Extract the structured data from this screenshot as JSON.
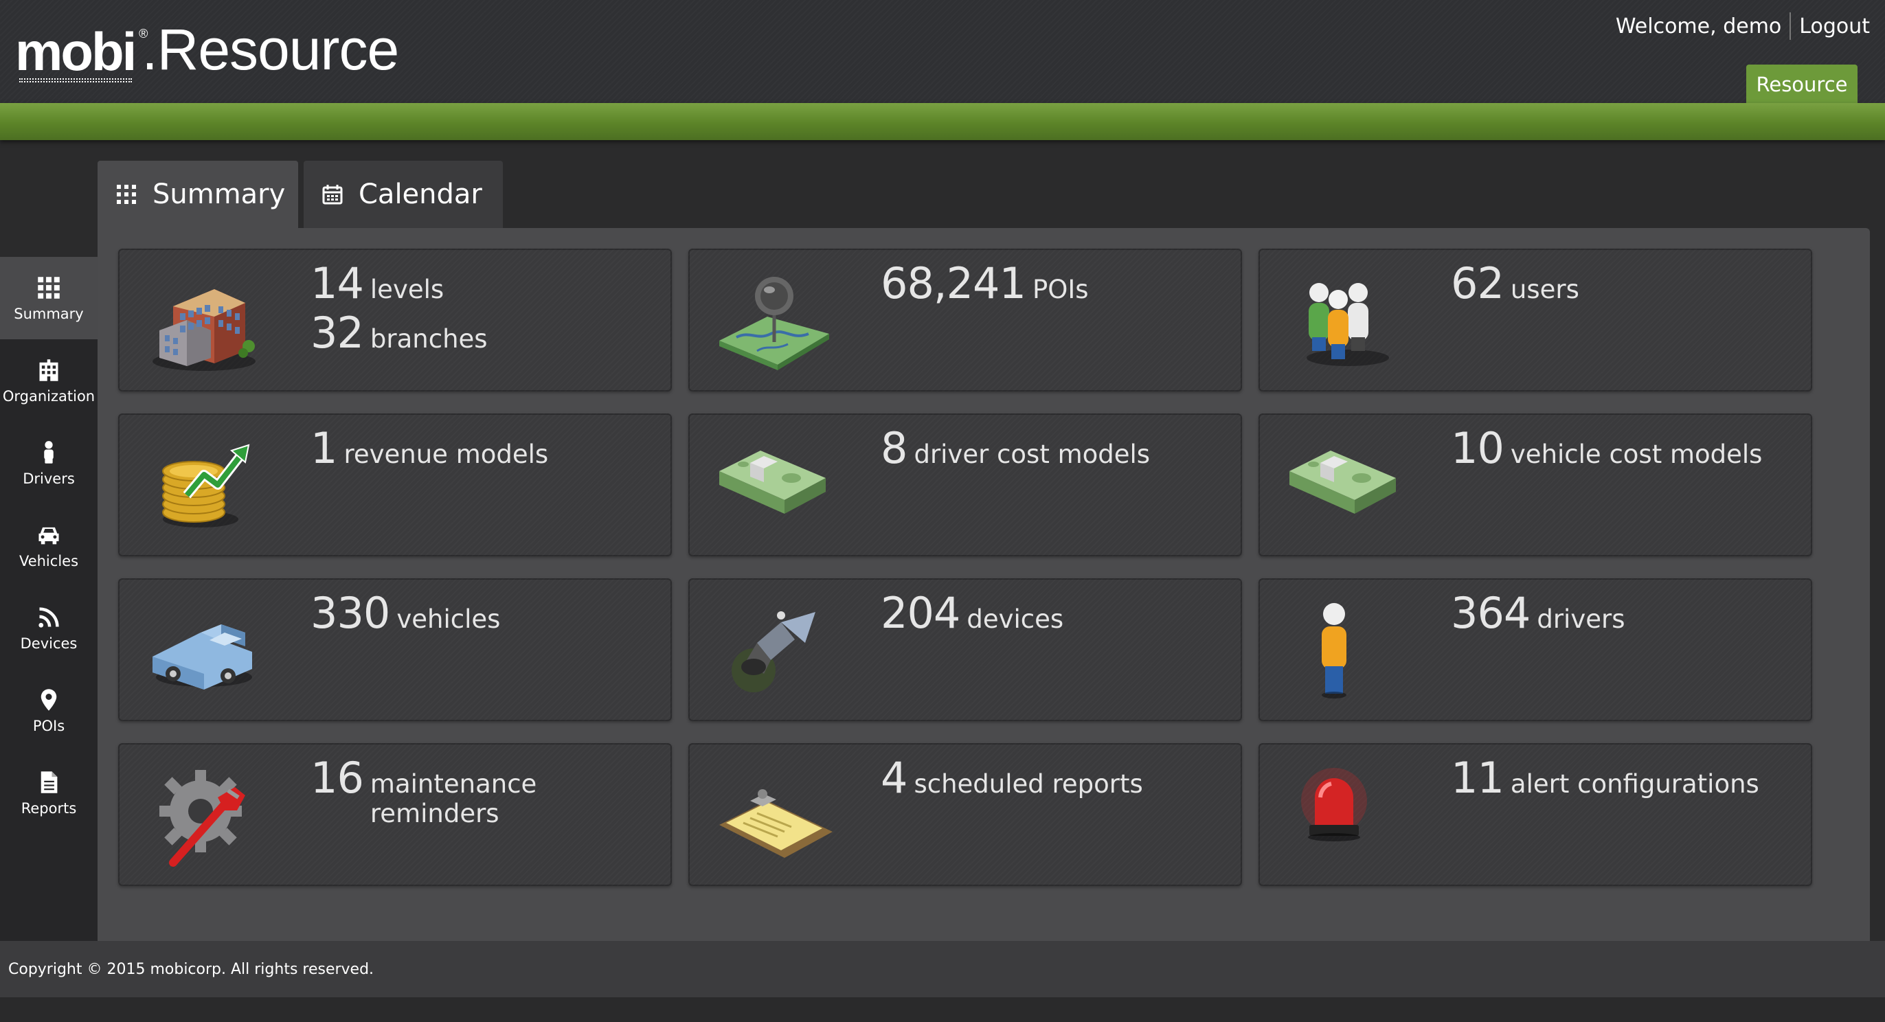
{
  "header": {
    "logo_brand": "mobi",
    "logo_reg": "®",
    "logo_product": ".Resource",
    "welcome": "Welcome, demo",
    "logout": "Logout",
    "resource_tab": "Resource"
  },
  "tabs": [
    {
      "label": "Summary",
      "icon": "grid-icon",
      "active": true
    },
    {
      "label": "Calendar",
      "icon": "calendar-icon",
      "active": false
    }
  ],
  "sidebar": {
    "items": [
      {
        "label": "Summary",
        "icon": "grid-icon"
      },
      {
        "label": "Organization",
        "icon": "building-icon"
      },
      {
        "label": "Drivers",
        "icon": "person-icon"
      },
      {
        "label": "Vehicles",
        "icon": "car-icon"
      },
      {
        "label": "Devices",
        "icon": "rss-icon"
      },
      {
        "label": "POIs",
        "icon": "map-pin-icon"
      },
      {
        "label": "Reports",
        "icon": "document-icon"
      }
    ]
  },
  "cards": [
    {
      "icon": "buildings-icon",
      "stats": [
        {
          "num": "14",
          "label": "levels"
        },
        {
          "num": "32",
          "label": "branches"
        }
      ]
    },
    {
      "icon": "map-pin-icon",
      "stats": [
        {
          "num": "68,241",
          "label": "POIs"
        }
      ]
    },
    {
      "icon": "users-icon",
      "stats": [
        {
          "num": "62",
          "label": "users"
        }
      ]
    },
    {
      "icon": "coins-chart-icon",
      "stats": [
        {
          "num": "1",
          "label": "revenue models"
        }
      ]
    },
    {
      "icon": "money-icon",
      "stats": [
        {
          "num": "8",
          "label": "driver cost models"
        }
      ]
    },
    {
      "icon": "money-icon",
      "stats": [
        {
          "num": "10",
          "label": "vehicle cost models"
        }
      ]
    },
    {
      "icon": "pickup-truck-icon",
      "stats": [
        {
          "num": "330",
          "label": "vehicles"
        }
      ]
    },
    {
      "icon": "satellite-icon",
      "stats": [
        {
          "num": "204",
          "label": "devices"
        }
      ]
    },
    {
      "icon": "driver-icon",
      "stats": [
        {
          "num": "364",
          "label": "drivers"
        }
      ]
    },
    {
      "icon": "gear-wrench-icon",
      "stats": [
        {
          "num": "16",
          "label": "maintenance reminders"
        }
      ]
    },
    {
      "icon": "clipboard-icon",
      "stats": [
        {
          "num": "4",
          "label": "scheduled reports"
        }
      ]
    },
    {
      "icon": "siren-icon",
      "stats": [
        {
          "num": "11",
          "label": "alert configurations"
        }
      ]
    }
  ],
  "colors": {
    "accent_green": "#6d9a3a",
    "panel": "#4b4b4d",
    "card": "#3a3a3c"
  },
  "footer": {
    "copyright": "Copyright © 2015 mobicorp. All rights reserved."
  }
}
